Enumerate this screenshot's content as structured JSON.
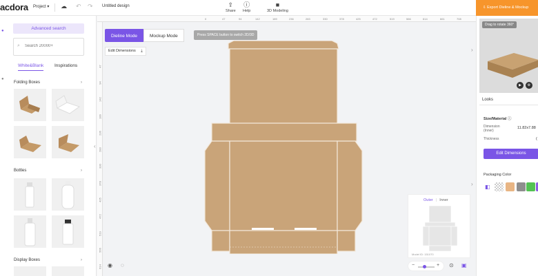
{
  "app": {
    "logo": "acdora",
    "project_label": "Project ▾",
    "title": "Untitled design"
  },
  "toolbar": {
    "share_label": "Share",
    "help_label": "Help",
    "modeling_label": "3D Modeling",
    "export_label": "Export Dieline & Mockup"
  },
  "sidebar": {
    "advanced_search": "Advanced search",
    "search_placeholder": "Search 20000+",
    "tab_blank": "White&Blank",
    "tab_inspirations": "Inspirations",
    "sections": [
      {
        "title": "Folding Boxes",
        "chevron": "›"
      },
      {
        "title": "Bottles",
        "chevron": "›"
      },
      {
        "title": "Display Boxes",
        "chevron": "›"
      }
    ]
  },
  "canvas": {
    "dieline_mode": "Dieline Mode",
    "mockup_mode": "Mockup Mode",
    "hint": "Press SPACE button to switch 2D/3D",
    "edit_dimensions": "Edit Dimensions",
    "ruler_top": [
      "0",
      "47",
      "94",
      "142",
      "189",
      "236",
      "283",
      "330",
      "378",
      "425",
      "472",
      "519",
      "566",
      "614",
      "661",
      "708"
    ],
    "ruler_left": [
      "47",
      "94",
      "142",
      "189",
      "236",
      "283",
      "330",
      "378",
      "425",
      "472",
      "519",
      "566",
      "614"
    ],
    "preview_outer": "Outer",
    "preview_inner": "Inner",
    "model_id": "Model ID: 151070"
  },
  "right_panel": {
    "rotate_hint": "Drag to rotate 360°",
    "looks_tab": "Looks",
    "size_material": "Size/Material",
    "dimension_label": "Dimension (Inner)",
    "dimension_value": "11.82x7.88",
    "thickness_label": "Thickness",
    "thickness_value": "(",
    "edit_dimensions": "Edit Dimensions",
    "packaging_color": "Packaging Color"
  },
  "colors": {
    "accent": "#7a55e6",
    "export": "#f7952b",
    "kraft": "#c9a479",
    "swatches": [
      "#e8b584",
      "#8e8e8e",
      "#53c253",
      "#8a5be0"
    ]
  }
}
